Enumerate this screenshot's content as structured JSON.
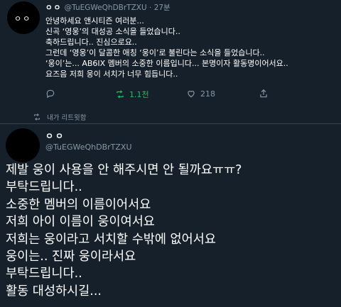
{
  "tweet1": {
    "avatar_text": "ㅇㅇ",
    "display_name": "ㅇㅇ",
    "handle": "@TuEGWeQhDBrTZXU",
    "separator": "·",
    "time": "27분",
    "lines": [
      "안녕하세요 앤시티즌 여러분...",
      "신곡 ‘영웅’의 대성공 소식을 들었습니다..",
      "축하드립니다.. 진심으로요..",
      "그런데 ‘영웅’이 달콤한 애칭 ‘웅이’로 불린다는 소식을 들었습니다..",
      "‘웅이’는... AB6IX 멤버의 소중한 이름입니다... 본명이자 활동명이어서요..",
      "요즈음 저희 웅이 서치가 너무 힘듭니다.."
    ],
    "retweet_count": "1.1천",
    "like_count": "218",
    "retweeted_label": "내가 리트윗함"
  },
  "tweet2": {
    "display_name": "ㅇㅇ",
    "handle": "@TuEGWeQhDBrTZXU",
    "lines": [
      "제발 웅이 사용을 안 해주시면 안 될까요ㅠㅠ?",
      "부탁드립니다..",
      "소중한 멤버의 이름이어서요",
      "저희 아이 이름이 웅이여서요",
      "저희는 웅이라고 서치할 수밖에 없어서요",
      "웅이는.. 진짜 웅이라서요",
      "부탁드립니다..",
      "활동 대성하시길..."
    ]
  },
  "colors": {
    "background": "#15202b",
    "text": "#ffffff",
    "secondary": "#8899a6",
    "retweet_active": "#17bf63",
    "divider": "#38444d"
  },
  "icons": [
    "reply-icon",
    "retweet-icon",
    "like-icon",
    "share-icon"
  ]
}
